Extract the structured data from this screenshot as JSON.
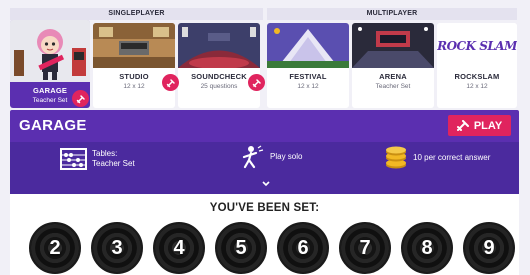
{
  "modes": {
    "singleplayer_label": "SINGLEPLAYER",
    "multiplayer_label": "MULTIPLAYER",
    "cards": [
      {
        "name": "GARAGE",
        "sub": "Teacher Set",
        "selected": true
      },
      {
        "name": "STUDIO",
        "sub": "12 x 12"
      },
      {
        "name": "SOUNDCHECK",
        "sub": "25 questions"
      },
      {
        "name": "FESTIVAL",
        "sub": "12 x 12"
      },
      {
        "name": "ARENA",
        "sub": "Teacher Set"
      },
      {
        "name": "ROCKSLAM",
        "sub": "12 x 12",
        "logo_text": "ROCK SLAM"
      }
    ]
  },
  "header": {
    "title": "GARAGE",
    "play_label": "PLAY"
  },
  "info": {
    "tables_line1": "Tables:",
    "tables_line2": "Teacher Set",
    "play_solo": "Play solo",
    "reward": "10 per correct answer"
  },
  "set_panel": {
    "title": "YOU'VE BEEN SET:",
    "records": [
      "2",
      "3",
      "4",
      "5",
      "6",
      "7",
      "8",
      "9"
    ]
  },
  "colors": {
    "purple": "#5b2fb0",
    "dark_purple": "#4b2a9e",
    "pink": "#e0245e",
    "gold": "#f2b824"
  },
  "icons": [
    "guitar-icon",
    "abacus-icon",
    "solo-player-icon",
    "coins-icon",
    "chevron-down-icon"
  ]
}
